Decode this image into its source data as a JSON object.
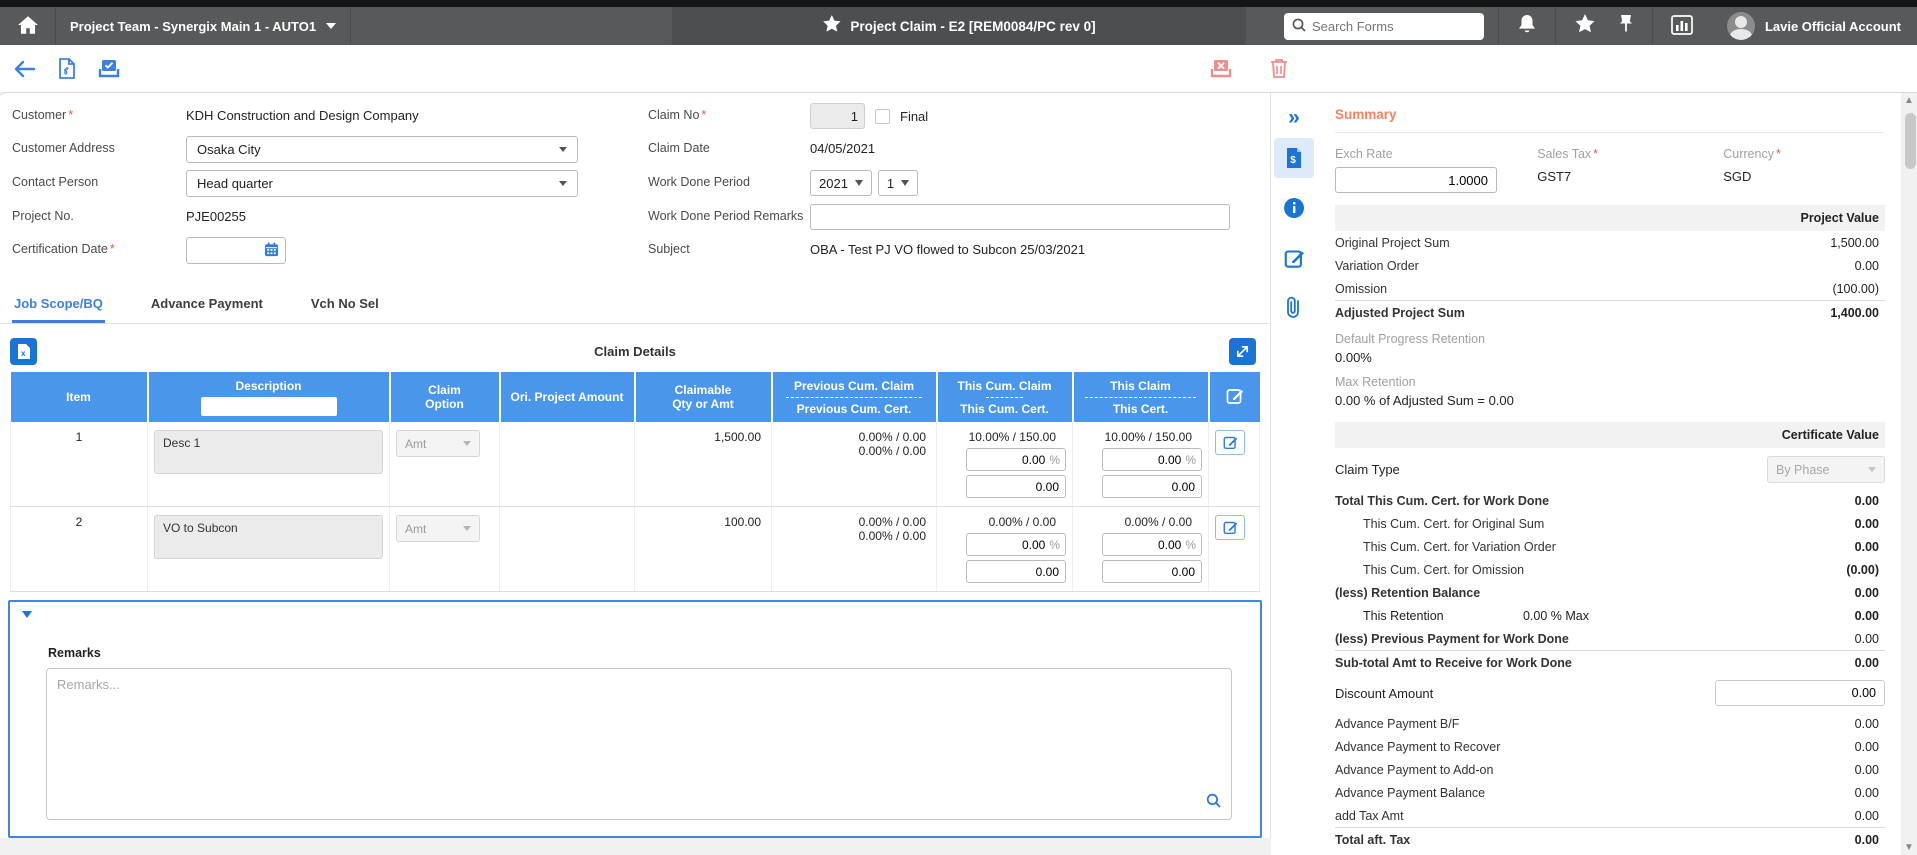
{
  "topbar": {
    "team": "Project Team - Synergix Main 1 - AUTO1",
    "title": "Project Claim - E2 [REM0084/PC rev 0]",
    "search_placeholder": "Search Forms",
    "account": "Lavie Official Account"
  },
  "form": {
    "customer_label": "Customer",
    "customer_value": "KDH Construction and Design Company",
    "customer_address_label": "Customer Address",
    "customer_address_value": "Osaka City",
    "contact_person_label": "Contact Person",
    "contact_person_value": "Head quarter",
    "project_no_label": "Project No.",
    "project_no_value": "PJE00255",
    "certification_date_label": "Certification Date",
    "claim_no_label": "Claim No",
    "claim_no_value": "1",
    "final_label": "Final",
    "claim_date_label": "Claim Date",
    "claim_date_value": "04/05/2021",
    "work_done_period_label": "Work Done Period",
    "work_done_year": "2021",
    "work_done_period": "1",
    "work_done_remarks_label": "Work Done Period Remarks",
    "subject_label": "Subject",
    "subject_value": "OBA - Test PJ VO flowed to Subcon 25/03/2021"
  },
  "tabs": {
    "tab1": "Job Scope/BQ",
    "tab2": "Advance Payment",
    "tab3": "Vch No Sel"
  },
  "table": {
    "title": "Claim Details",
    "col_item": "Item",
    "col_description": "Description",
    "col_claim_option_1": "Claim",
    "col_claim_option_2": "Option",
    "col_ori_amount": "Ori. Project Amount",
    "col_claimable_1": "Claimable",
    "col_claimable_2": "Qty or Amt",
    "col_prev_claim": "Previous Cum. Claim",
    "col_prev_cert": "Previous Cum. Cert.",
    "col_this_cum_claim": "This Cum. Claim",
    "col_this_cum_cert": "This Cum. Cert.",
    "col_this_claim": "This Claim",
    "col_this_cert": "This Cert.",
    "pct_suffix": "%",
    "rows": [
      {
        "item": "1",
        "description": "Desc 1",
        "claim_option": "Amt",
        "ori_amount": "",
        "claimable": "1,500.00",
        "prev1": "0.00% / 0.00",
        "prev2": "0.00% / 0.00",
        "cum_text": "10.00% / 150.00",
        "cum_pct": "0.00",
        "cum_amt": "0.00",
        "this_text": "10.00% / 150.00",
        "this_pct": "0.00",
        "this_amt": "0.00"
      },
      {
        "item": "2",
        "description": "VO to Subcon",
        "claim_option": "Amt",
        "ori_amount": "",
        "claimable": "100.00",
        "prev1": "0.00% / 0.00",
        "prev2": "0.00% / 0.00",
        "cum_text": "0.00% / 0.00",
        "cum_pct": "0.00",
        "cum_amt": "0.00",
        "this_text": "0.00% / 0.00",
        "this_pct": "0.00",
        "this_amt": "0.00"
      }
    ]
  },
  "remarks": {
    "label": "Remarks",
    "placeholder": "Remarks..."
  },
  "summary": {
    "title": "Summary",
    "exch_rate_label": "Exch Rate",
    "exch_rate_value": "1.0000",
    "sales_tax_label": "Sales Tax",
    "sales_tax_value": "GST7",
    "currency_label": "Currency",
    "currency_value": "SGD",
    "project_value_header": "Project Value",
    "original_project_sum_label": "Original Project Sum",
    "original_project_sum": "1,500.00",
    "variation_order_label": "Variation Order",
    "variation_order": "0.00",
    "omission_label": "Omission",
    "omission": "(100.00)",
    "adjusted_label": "Adjusted Project Sum",
    "adjusted": "1,400.00",
    "default_retention_label": "Default Progress Retention",
    "default_retention": "0.00%",
    "max_retention_label": "Max Retention",
    "max_retention": "0.00 % of Adjusted Sum = 0.00",
    "certificate_header": "Certificate Value",
    "claim_type_label": "Claim Type",
    "claim_type_value": "By Phase",
    "total_cum_label": "Total This Cum. Cert. for Work Done",
    "total_cum": "0.00",
    "cum_original_label": "This Cum. Cert. for Original Sum",
    "cum_original": "0.00",
    "cum_vo_label": "This Cum. Cert. for Variation Order",
    "cum_vo": "0.00",
    "cum_omission_label": "This Cum. Cert. for Omission",
    "cum_omission": "(0.00)",
    "less_retention_label": "(less) Retention Balance",
    "less_retention": "0.00",
    "this_retention_label": "This Retention",
    "this_retention_mid": "0.00  % Max",
    "this_retention": "0.00",
    "less_prev_label": "(less) Previous Payment for Work Done",
    "less_prev": "0.00",
    "subtotal_label": "Sub-total Amt to Receive for Work Done",
    "subtotal": "0.00",
    "discount_label": "Discount Amount",
    "discount_value": "0.00",
    "adv_bf_label": "Advance Payment B/F",
    "adv_bf": "0.00",
    "adv_recover_label": "Advance Payment to Recover",
    "adv_recover": "0.00",
    "adv_addon_label": "Advance Payment to Add-on",
    "adv_addon": "0.00",
    "adv_balance_label": "Advance Payment Balance",
    "adv_balance": "0.00",
    "tax_amt_label": "add Tax Amt",
    "tax_amt": "0.00",
    "total_label": "Total aft. Tax",
    "total": "0.00"
  }
}
